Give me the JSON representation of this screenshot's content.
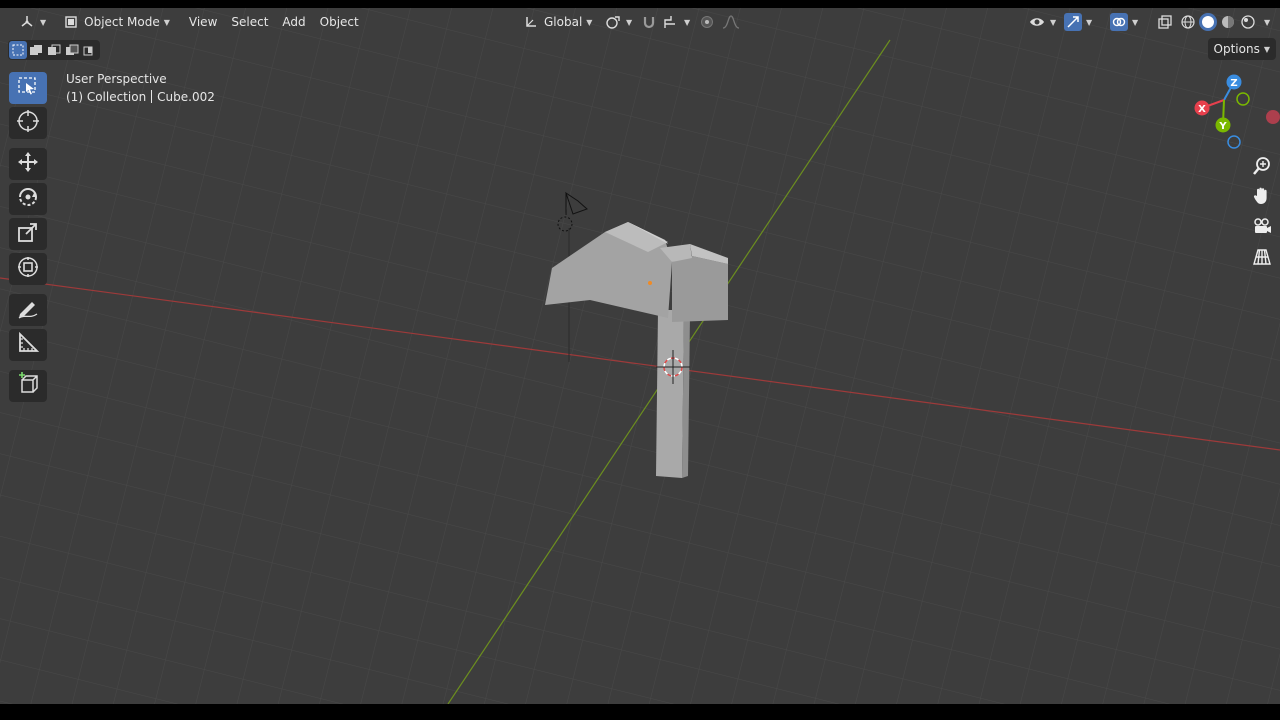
{
  "header": {
    "editor_type_icon": "view3d-icon",
    "mode_label": "Object Mode",
    "menus": [
      "View",
      "Select",
      "Add",
      "Object"
    ],
    "transform_orientation": "Global",
    "options_label": "Options"
  },
  "viewport": {
    "perspective_label": "User Perspective",
    "collection_label": "(1) Collection",
    "active_object": "Cube.002"
  },
  "toolbar": {
    "tools": [
      "select-box",
      "cursor",
      "move",
      "rotate",
      "scale",
      "transform",
      "annotate",
      "measure",
      "add-cube"
    ],
    "active_tool": "select-box"
  },
  "gizmo": {
    "axis_labels": {
      "x": "X",
      "y": "Y",
      "z": "Z"
    },
    "colors": {
      "x": "#e7404d",
      "y": "#7ab800",
      "z": "#3a8de0"
    }
  },
  "colors": {
    "background": "#3d3d3d",
    "accent": "#4772b3",
    "x_axis_line": "#9e3a3a",
    "y_axis_line": "#6c8e1f"
  }
}
